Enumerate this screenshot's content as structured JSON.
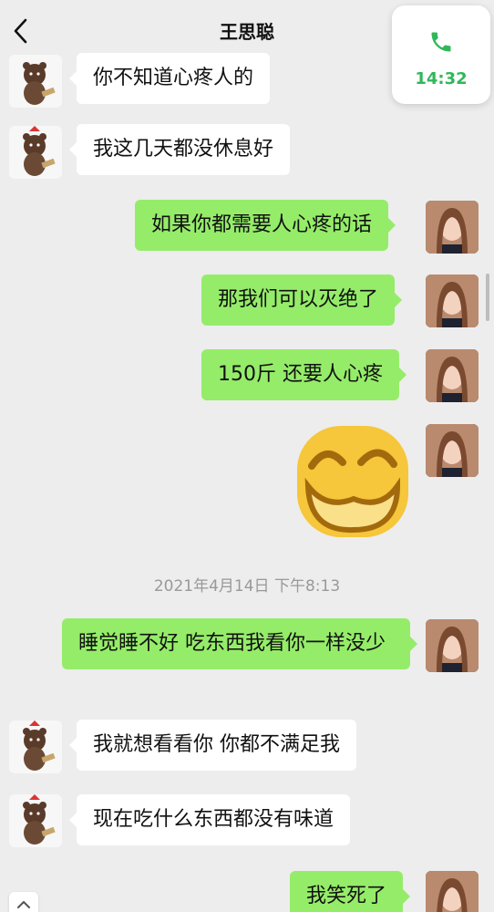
{
  "header": {
    "title": "王思聪"
  },
  "call": {
    "time": "14:32"
  },
  "messages": [
    {
      "side": "left",
      "text": "你不知道心疼人的"
    },
    {
      "side": "left",
      "text": "我这几天都没休息好"
    },
    {
      "side": "right",
      "text": "如果你都需要人心疼的话"
    },
    {
      "side": "right",
      "text": "那我们可以灭绝了"
    },
    {
      "side": "right",
      "text": "150斤 还要人心疼"
    },
    {
      "side": "right",
      "sticker": "emoji-sticker"
    },
    {
      "side": "right",
      "text": "睡觉睡不好 吃东西我看你一样没少"
    },
    {
      "side": "left",
      "text": "我就想看看你 你都不满足我"
    },
    {
      "side": "left",
      "text": "现在吃什么东西都没有味道"
    },
    {
      "side": "right",
      "text": "我笑死了"
    }
  ],
  "timestamp": "2021年4月14日 下午8:13",
  "colors": {
    "call_green": "#2fb85a",
    "bubble_green": "#95ec69",
    "background": "#ededed"
  },
  "icons": {
    "back": "chevron-left-icon",
    "phone": "phone-icon",
    "scroll_up": "chevron-up-icon"
  }
}
